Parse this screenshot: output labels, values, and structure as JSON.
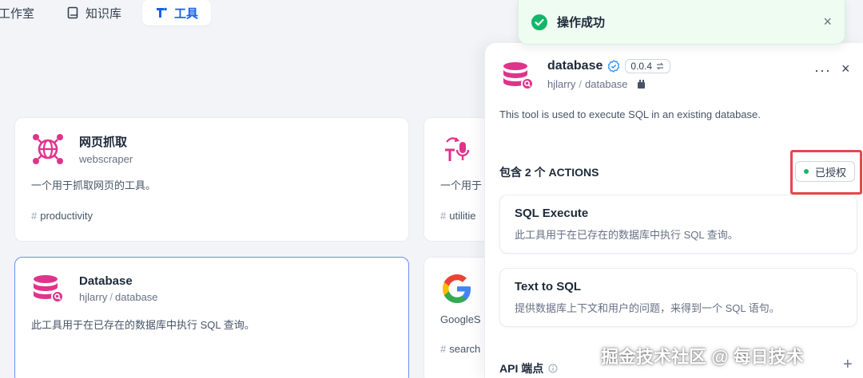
{
  "nav": {
    "tabs": [
      {
        "label": "工作室"
      },
      {
        "label": "知识库"
      },
      {
        "label": "工具"
      }
    ]
  },
  "cards": [
    {
      "title": "网页抓取",
      "sub": "webscraper",
      "desc": "一个用于抓取网页的工具。",
      "tag": "productivity"
    },
    {
      "sub_visible": "",
      "desc": "一个用于",
      "tag": "utilitie"
    },
    {
      "title": "Database",
      "author": "hjlarry",
      "name": "database",
      "desc": "此工具用于在已存在的数据库中执行 SQL 查询。"
    },
    {
      "desc": "GoogleS",
      "tag": "search"
    }
  ],
  "toast": {
    "text": "操作成功",
    "close": "×"
  },
  "panel": {
    "name": "database",
    "version": "0.0.4",
    "author": "hjlarry",
    "repo": "database",
    "more": "···",
    "close": "×",
    "description": "This tool is used to execute SQL in an existing database.",
    "actions_title": "包含 2 个 ACTIONS",
    "auth_label": "已授权",
    "actions": [
      {
        "name": "SQL Execute",
        "desc": "此工具用于在已存在的数据库中执行 SQL 查询。"
      },
      {
        "name": "Text to SQL",
        "desc": "提供数据库上下文和用户的问题，来得到一个 SQL 语句。"
      }
    ],
    "api_title": "API 端点",
    "api_add": "+"
  },
  "watermark": "掘金技术社区 @ 每日技术",
  "colors": {
    "accent": "#155eef",
    "brand_pink": "#e0338c",
    "success": "#12b76a",
    "highlight": "#e5484d"
  }
}
